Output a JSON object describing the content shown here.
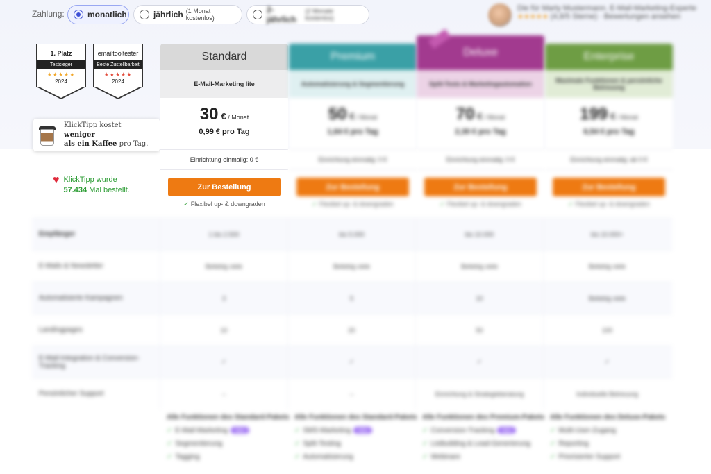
{
  "payment": {
    "label": "Zahlung:",
    "options": [
      {
        "label": "monatlich",
        "note": ""
      },
      {
        "label": "jährlich",
        "note": "(1 Monat kostenlos)"
      },
      {
        "label": "2-jährlich",
        "note": "(2 Monate kostenlos)"
      }
    ]
  },
  "review": {
    "line1": "Die für Marty Mustermann. E-Mail-Marketing-Experte",
    "stars": "★★★★★",
    "line2": "(4,8/5 Sterne) · Bewertungen ansehen"
  },
  "badges": [
    {
      "title": "1. Platz",
      "band": "Testsieger",
      "stars": "★★★★★",
      "year": "2024"
    },
    {
      "title": "emailtooltester",
      "band": "Beste Zustellbarkeit",
      "stars": "★★★★★",
      "year": "2024"
    }
  ],
  "coffee": {
    "text_a": "KlickTipp kostet ",
    "text_bold_a": "weniger",
    "text_bold_b": "als ein Kaffee",
    "text_b": " pro Tag."
  },
  "orders": {
    "line1": "KlickTipp wurde",
    "count": "57.434",
    "suffix": " Mal bestellt."
  },
  "plans": [
    {
      "name": "Standard",
      "subtitle": "E-Mail-Marketing lite",
      "price": "30",
      "currency": "€",
      "period": "/ Monat",
      "per_day": "0,99 € pro Tag",
      "setup": "Einrichtung einmalig: 0 €",
      "cta": "Zur Bestellung",
      "flex": "Flexibel up- & downgraden"
    },
    {
      "name": "Premium",
      "subtitle": "Automatisierung & Segmentierung",
      "price": "50",
      "currency": "€",
      "period": "/ Monat",
      "per_day": "1,64 € pro Tag",
      "setup": "Einrichtung einmalig: 0 €",
      "cta": "Zur Bestellung",
      "flex": "Flexibel up- & downgraden"
    },
    {
      "name": "Deluxe",
      "subtitle": "Split-Tests & Marketingautomation",
      "price": "70",
      "currency": "€",
      "period": "/ Monat",
      "per_day": "2,30 € pro Tag",
      "setup": "Einrichtung einmalig: 0 €",
      "cta": "Zur Bestellung",
      "flex": "Flexibel up- & downgraden"
    },
    {
      "name": "Enterprise",
      "subtitle": "Maximale Funktionen & persönliche Betreuung",
      "price": "199",
      "currency": "€",
      "period": "/ Monat",
      "per_day": "6,54 € pro Tag",
      "setup": "Einrichtung einmalig: ab 0 €",
      "cta": "Zur Bestellung",
      "flex": "Flexibel up- & downgraden"
    }
  ],
  "features": [
    {
      "label": "Empfänger",
      "values": [
        "1 bis 2.500",
        "bis 5.000",
        "bis 10.000",
        "bis 10.000+"
      ]
    },
    {
      "label": "E-Mails & Newsletter",
      "values": [
        "Beliebig viele",
        "Beliebig viele",
        "Beliebig viele",
        "Beliebig viele"
      ]
    },
    {
      "label": "Automatisierte Kampagnen",
      "values": [
        "3",
        "5",
        "10",
        "Beliebig viele"
      ]
    },
    {
      "label": "Landingpages",
      "values": [
        "10",
        "20",
        "50",
        "100"
      ]
    },
    {
      "label": "E-Mail-Integration & Conversion-Tracking",
      "values": [
        "✓",
        "✓",
        "✓",
        "✓"
      ]
    },
    {
      "label": "Persönlicher Support",
      "values": [
        "–",
        "–",
        "Einrichtung & Strategieberatung",
        "Individuelle Betreuung"
      ]
    }
  ],
  "bottom": [
    [
      "Alle Funktionen des Standard-Pakets",
      "E-Mail-Marketing",
      "Segmentierung",
      "Tagging"
    ],
    [
      "Alle Funktionen des Standard-Pakets",
      "SMS-Marketing",
      "Split-Testing",
      "Automatisierung"
    ],
    [
      "Alle Funktionen des Premium-Pakets",
      "Conversion-Tracking",
      "Listbuilding & Lead-Generierung",
      "Webinare"
    ],
    [
      "Alle Funktionen des Deluxe-Pakets",
      "Multi-User-Zugang",
      "Reporting",
      "Priorisierter Support"
    ]
  ],
  "colors": {
    "accent": "#3f51d6",
    "cta": "#ee7a12",
    "standard": "#d9d9d9",
    "premium": "#3aa0a6",
    "deluxe": "#a23a8f",
    "enterprise": "#6e9d44",
    "success": "#2d9d35",
    "heart": "#e02a3b"
  }
}
